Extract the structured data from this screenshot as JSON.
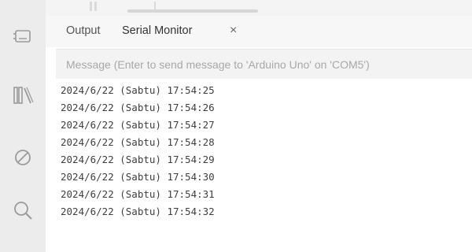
{
  "tabs": {
    "output_label": "Output",
    "serial_monitor_label": "Serial Monitor",
    "close_symbol": "×"
  },
  "message": {
    "placeholder": "Message (Enter to send message to 'Arduino Uno' on 'COM5')",
    "value": ""
  },
  "log_lines": [
    "2024/6/22 (Sabtu) 17:54:25",
    "2024/6/22 (Sabtu) 17:54:26",
    "2024/6/22 (Sabtu) 17:54:27",
    "2024/6/22 (Sabtu) 17:54:28",
    "2024/6/22 (Sabtu) 17:54:29",
    "2024/6/22 (Sabtu) 17:54:30",
    "2024/6/22 (Sabtu) 17:54:31",
    "2024/6/22 (Sabtu) 17:54:32"
  ],
  "icons": {
    "activity_bar": [
      "board-icon",
      "library-icon",
      "debug-icon",
      "search-icon"
    ]
  },
  "colors": {
    "activity_bar_bg": "#ececec",
    "icon_color": "#9a9a9a",
    "log_text": "#3f3f3f",
    "placeholder_text": "#a8a8a8"
  }
}
